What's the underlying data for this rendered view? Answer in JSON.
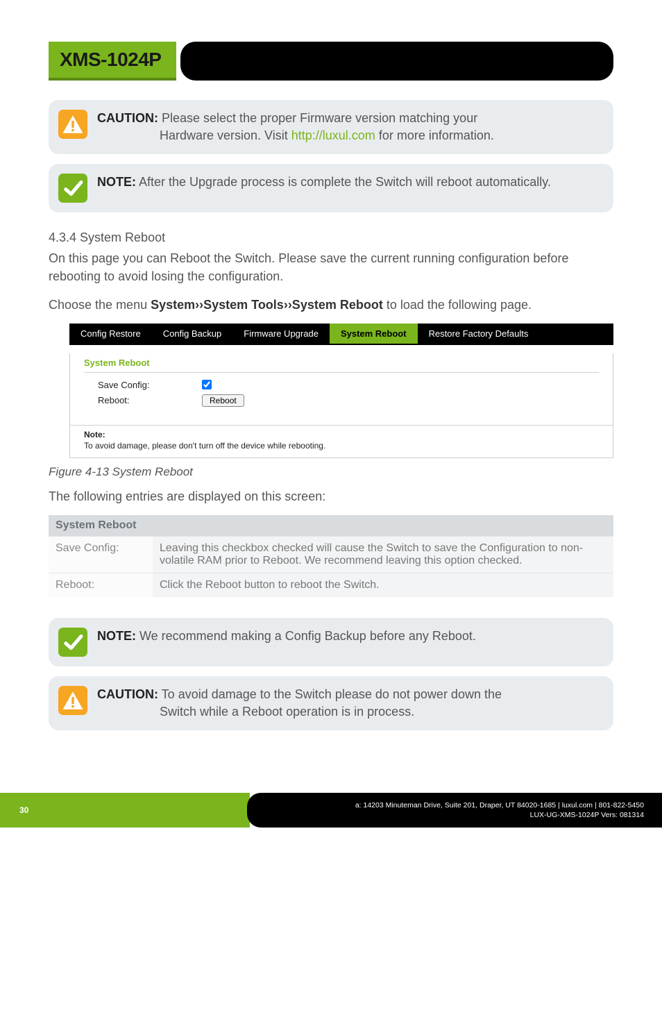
{
  "header": {
    "product": "XMS-1024P"
  },
  "callouts": {
    "caution1": {
      "label": "CAUTION:",
      "line1": " Please select the proper Firmware version matching your",
      "line2_prefix": "Hardware version. Visit ",
      "link": "http://luxul.com",
      "line2_suffix": " for more information."
    },
    "note1": {
      "label": "NOTE:",
      "text": " After the Upgrade process is complete the Switch will reboot automatically."
    },
    "note2": {
      "label": "NOTE:",
      "text": " We recommend making a Config Backup before any Reboot."
    },
    "caution2": {
      "label": "CAUTION:",
      "line1": " To avoid damage to the Switch please do not power down the",
      "line2": "Switch while a Reboot operation is in process."
    }
  },
  "section": {
    "heading": "4.3.4 System Reboot",
    "para1": "On this page you can Reboot the Switch. Please save the current running configuration before rebooting to avoid losing the configuration.",
    "para2_pre": "Choose the menu ",
    "para2_bold": "System››System Tools››System Reboot",
    "para2_post": " to load the following page."
  },
  "figure": {
    "tabs": {
      "t0": "Config Restore",
      "t1": "Config Backup",
      "t2": "Firmware Upgrade",
      "t3": "System Reboot",
      "t4": "Restore Factory Defaults"
    },
    "panel_heading": "System Reboot",
    "row_saveconfig": "Save Config:",
    "row_reboot": "Reboot:",
    "reboot_button": "Reboot",
    "note_label": "Note:",
    "note_text": "To avoid damage, please don't turn off the device while rebooting.",
    "caption": "Figure 4-13 System Reboot"
  },
  "table_intro": "The following entries are displayed on this screen:",
  "table": {
    "header": "System Reboot",
    "r0k": "Save Config:",
    "r0v": "Leaving this checkbox checked will cause the Switch to save the Configuration to non-volatile RAM prior to Reboot. We recommend leaving this option checked.",
    "r1k": "Reboot:",
    "r1v": "Click the Reboot button to reboot the Switch."
  },
  "footer": {
    "page": "30",
    "line1": "a: 14203 Minuteman Drive, Suite 201, Draper, UT 84020-1685 | luxul.com | 801-822-5450",
    "line2": "LUX-UG-XMS-1024P  Vers: 081314"
  }
}
